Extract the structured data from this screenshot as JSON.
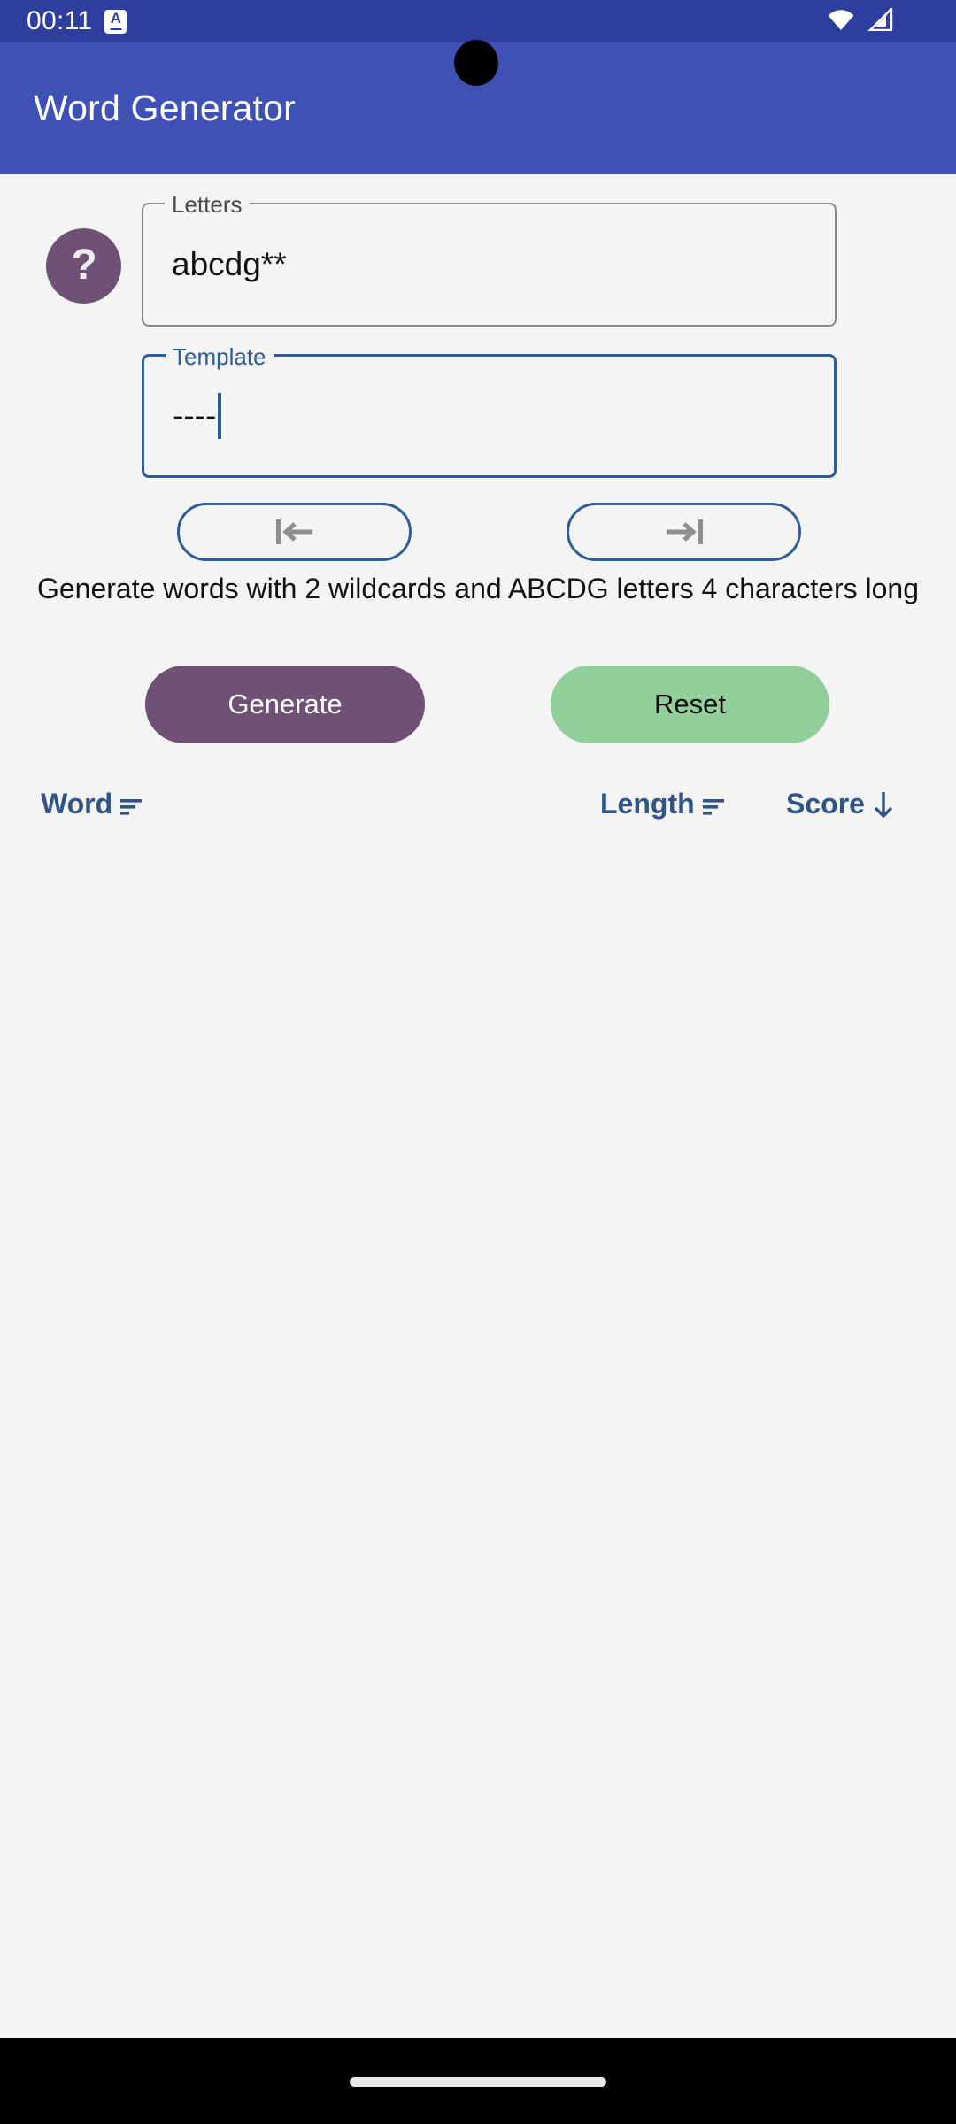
{
  "status_bar": {
    "time": "00:11",
    "notification_icon_letter": "A",
    "icons": [
      "notification-badge-icon",
      "wifi-icon",
      "cell-signal-icon"
    ],
    "background_color": "#2F3E9E"
  },
  "app_bar": {
    "title": "Word Generator",
    "background_color": "#3F51B5",
    "text_color": "#FFFFFF"
  },
  "help": {
    "icon": "help-question-icon",
    "glyph": "?",
    "color": "#6E5175"
  },
  "form": {
    "letters": {
      "label": "Letters",
      "value": "abcdg**",
      "focused": false,
      "border_color": "#8A8A8A"
    },
    "template": {
      "label": "Template",
      "value": "----",
      "focused": true,
      "has_caret": true,
      "border_color": "#2F5C96",
      "label_color": "#2F5C96"
    }
  },
  "nav_buttons": [
    {
      "name": "move-to-start-button",
      "icon": "arrow-left-to-bar-icon",
      "label": ""
    },
    {
      "name": "move-to-end-button",
      "icon": "arrow-right-to-bar-icon",
      "label": ""
    }
  ],
  "description": "Generate words with 2 wildcards and ABCDG letters 4 characters long",
  "actions": {
    "generate": {
      "label": "Generate",
      "background": "#6E5175",
      "color": "#FFFFFF"
    },
    "reset": {
      "label": "Reset",
      "background": "#92D09B",
      "color": "#0B0B0B"
    }
  },
  "sort_headers": [
    {
      "label": "Word",
      "icon": "sort-lines-icon"
    },
    {
      "label": "Length",
      "icon": "sort-lines-icon"
    },
    {
      "label": "Score",
      "icon": "arrow-down-icon"
    }
  ],
  "results": {
    "rows": [],
    "empty": true
  },
  "nav_bar": {
    "gesture_indicator": "home-indicator",
    "background_color": "#000000"
  }
}
